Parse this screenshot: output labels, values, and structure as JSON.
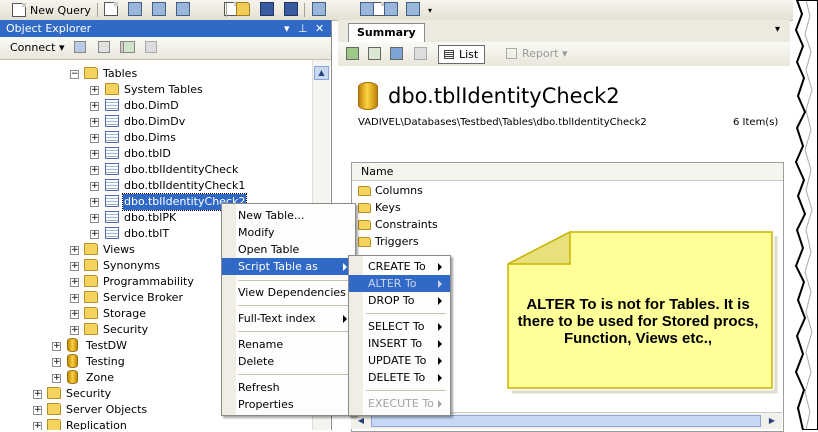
{
  "toolbar": {
    "new_query_label": "New Query"
  },
  "object_explorer": {
    "title": "Object Explorer",
    "title_controls": [
      "▾",
      "⊥",
      "✕"
    ],
    "connect_label": "Connect",
    "tree": [
      {
        "label": "Tables",
        "icon": "folder-icon",
        "expander": "−"
      },
      {
        "label": "System Tables",
        "icon": "folder-icon",
        "expander": "+"
      },
      {
        "label": "dbo.DimD",
        "icon": "table-icon",
        "expander": "+"
      },
      {
        "label": "dbo.DimDv",
        "icon": "table-icon",
        "expander": "+"
      },
      {
        "label": "dbo.Dims",
        "icon": "table-icon",
        "expander": "+"
      },
      {
        "label": "dbo.tblD",
        "icon": "table-icon",
        "expander": "+"
      },
      {
        "label": "dbo.tblIdentityCheck",
        "icon": "table-icon",
        "expander": "+"
      },
      {
        "label": "dbo.tblIdentityCheck1",
        "icon": "table-icon",
        "expander": "+"
      },
      {
        "label": "dbo.tblIdentityCheck2",
        "icon": "table-icon",
        "expander": "+",
        "selected": true
      },
      {
        "label": "dbo.tblPK",
        "icon": "table-icon",
        "expander": "+"
      },
      {
        "label": "dbo.tblT",
        "icon": "table-icon",
        "expander": "+"
      },
      {
        "label": "Views",
        "icon": "folder-icon",
        "expander": "+"
      },
      {
        "label": "Synonyms",
        "icon": "folder-icon",
        "expander": "+"
      },
      {
        "label": "Programmability",
        "icon": "folder-icon",
        "expander": "+"
      },
      {
        "label": "Service Broker",
        "icon": "folder-icon",
        "expander": "+"
      },
      {
        "label": "Storage",
        "icon": "folder-icon",
        "expander": "+"
      },
      {
        "label": "Security",
        "icon": "folder-icon",
        "expander": "+"
      },
      {
        "label": "TestDW",
        "icon": "database-icon",
        "expander": "+"
      },
      {
        "label": "Testing",
        "icon": "database-icon",
        "expander": "+"
      },
      {
        "label": "Zone",
        "icon": "database-icon",
        "expander": "+"
      },
      {
        "label": "Security",
        "icon": "folder-icon",
        "expander": "+"
      },
      {
        "label": "Server Objects",
        "icon": "folder-icon",
        "expander": "+"
      },
      {
        "label": "Replication",
        "icon": "folder-icon",
        "expander": "+"
      }
    ]
  },
  "summary": {
    "tab_label": "Summary",
    "list_label": "List",
    "report_label": "Report",
    "object_name": "dbo.tblIdentityCheck2",
    "path": "VADIVEL\\Databases\\Testbed\\Tables\\dbo.tblIdentityCheck2",
    "item_count": "6 Item(s)",
    "column_header": "Name",
    "items": [
      "Columns",
      "Keys",
      "Constraints",
      "Triggers"
    ]
  },
  "context_menu": {
    "items": [
      "New Table...",
      "Modify",
      "Open Table",
      "Script Table as",
      "View Dependencies",
      "Full-Text index",
      "Rename",
      "Delete",
      "Refresh",
      "Properties"
    ]
  },
  "submenu": {
    "items": [
      "CREATE To",
      "ALTER To",
      "DROP To",
      "SELECT To",
      "INSERT To",
      "UPDATE To",
      "DELETE To",
      "EXECUTE To"
    ]
  },
  "callout": {
    "text": "ALTER To is not for Tables. It is there to be used for Stored procs, Function, Views etc.,"
  },
  "colors": {
    "selection": "#3169c6",
    "note_fill": "#ffff99",
    "note_border": "#c8b400"
  }
}
